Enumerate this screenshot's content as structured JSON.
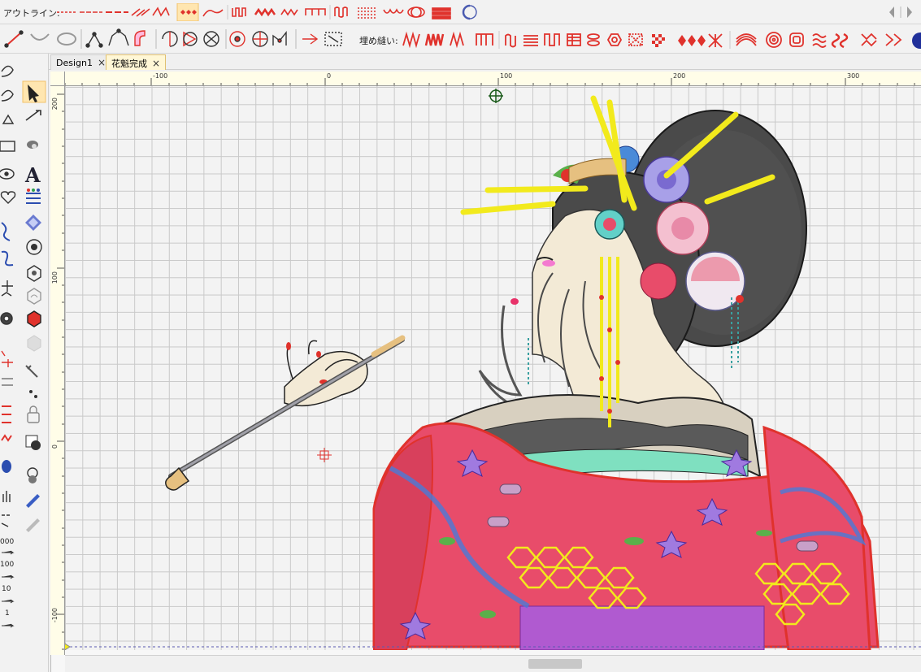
{
  "toolbar1": {
    "outline_label": "アウトライン:"
  },
  "toolbar2": {
    "fill_label": "埋め縫い:"
  },
  "tabs": [
    {
      "label": "Design1",
      "close": "×"
    },
    {
      "label": "花魁完成",
      "close": "×"
    }
  ],
  "ruler": {
    "top": [
      "-100",
      "0",
      "100",
      "200",
      "300"
    ],
    "left": [
      "200",
      "100",
      "0",
      "-100"
    ]
  },
  "palette_labels": [
    "000",
    "100",
    "10",
    "1"
  ],
  "colors": {
    "accent_red": "#e0322c",
    "selection": "#ffe6b0",
    "kimono": "#e84c6a",
    "hair": "#4a4a4a",
    "skin": "#f3ead6",
    "gold": "#f2ea1c"
  }
}
